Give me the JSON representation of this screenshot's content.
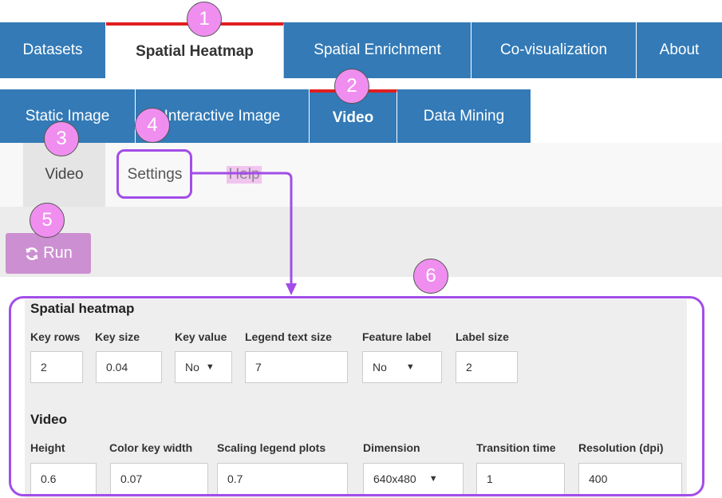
{
  "nav_primary": {
    "items": [
      {
        "label": "Datasets",
        "active": false
      },
      {
        "label": "Spatial Heatmap",
        "active": true
      },
      {
        "label": "Spatial Enrichment",
        "active": false
      },
      {
        "label": "Co-visualization",
        "active": false
      },
      {
        "label": "About",
        "active": false
      }
    ]
  },
  "nav_secondary": {
    "items": [
      {
        "label": "Static Image",
        "active": false
      },
      {
        "label": "Interactive Image",
        "active": false
      },
      {
        "label": "Video",
        "active": true
      },
      {
        "label": "Data Mining",
        "active": false
      }
    ]
  },
  "subtabs": {
    "video": "Video",
    "settings": "Settings",
    "help": "Help"
  },
  "run_button": {
    "label": "Run",
    "icon": "refresh-icon"
  },
  "spatial_heatmap": {
    "title": "Spatial heatmap",
    "fields": [
      {
        "label": "Key rows",
        "value": "2"
      },
      {
        "label": "Key size",
        "value": "0.04"
      },
      {
        "label": "Key value",
        "value": "No"
      },
      {
        "label": "Legend text size",
        "value": "7"
      },
      {
        "label": "Feature label",
        "value": "No"
      },
      {
        "label": "Label size",
        "value": "2"
      }
    ]
  },
  "video_settings": {
    "title": "Video",
    "fields": [
      {
        "label": "Height",
        "value": "0.6"
      },
      {
        "label": "Color key width",
        "value": "0.07"
      },
      {
        "label": "Scaling legend plots",
        "value": "0.7"
      },
      {
        "label": "Dimension",
        "value": "640x480"
      },
      {
        "label": "Transition time",
        "value": "1"
      },
      {
        "label": "Resolution (dpi)",
        "value": "400"
      }
    ]
  },
  "annotations": [
    "1",
    "2",
    "3",
    "4",
    "5",
    "6"
  ],
  "colors": {
    "nav_blue": "#337ab7",
    "active_red": "#e01e1e",
    "callout_purple": "#a24de8",
    "marker_pink": "#f08ef0",
    "run_button": "#cc8fd1"
  }
}
